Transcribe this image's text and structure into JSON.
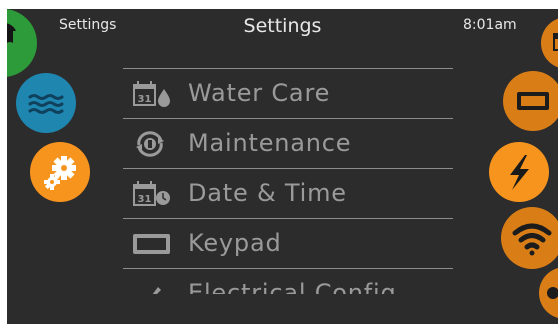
{
  "header": {
    "left_label": "Settings",
    "title": "Settings",
    "time": "8:01am"
  },
  "left_nav": [
    {
      "icon": "music-note-icon",
      "color": "#2e9b3a"
    },
    {
      "icon": "water-waves-icon",
      "color": "#1f86b0"
    },
    {
      "icon": "gears-icon",
      "color": "#f7941d",
      "selected": true
    }
  ],
  "right_nav": [
    {
      "icon": "calendar-icon",
      "color": "#d97d17"
    },
    {
      "icon": "keypad-icon",
      "color": "#d97d17"
    },
    {
      "icon": "lightning-icon",
      "color": "#f7941d",
      "selected": true
    },
    {
      "icon": "wifi-icon",
      "color": "#d97d17"
    },
    {
      "icon": "settings-icon",
      "color": "#d97d17"
    }
  ],
  "menu": {
    "items": [
      {
        "label": "Water Care",
        "icon": "calendar-drop-icon"
      },
      {
        "label": "Maintenance",
        "icon": "maintenance-icon"
      },
      {
        "label": "Date & Time",
        "icon": "calendar-clock-icon"
      },
      {
        "label": "Keypad",
        "icon": "keypad-icon"
      },
      {
        "label": "Electrical Config",
        "icon": "pen-icon"
      }
    ],
    "calendar_day": "31"
  },
  "colors": {
    "screen_bg": "#2c2c2c",
    "text": "#9a9a9a",
    "separator": "#8c8c8c",
    "accent_orange": "#f7941d"
  }
}
